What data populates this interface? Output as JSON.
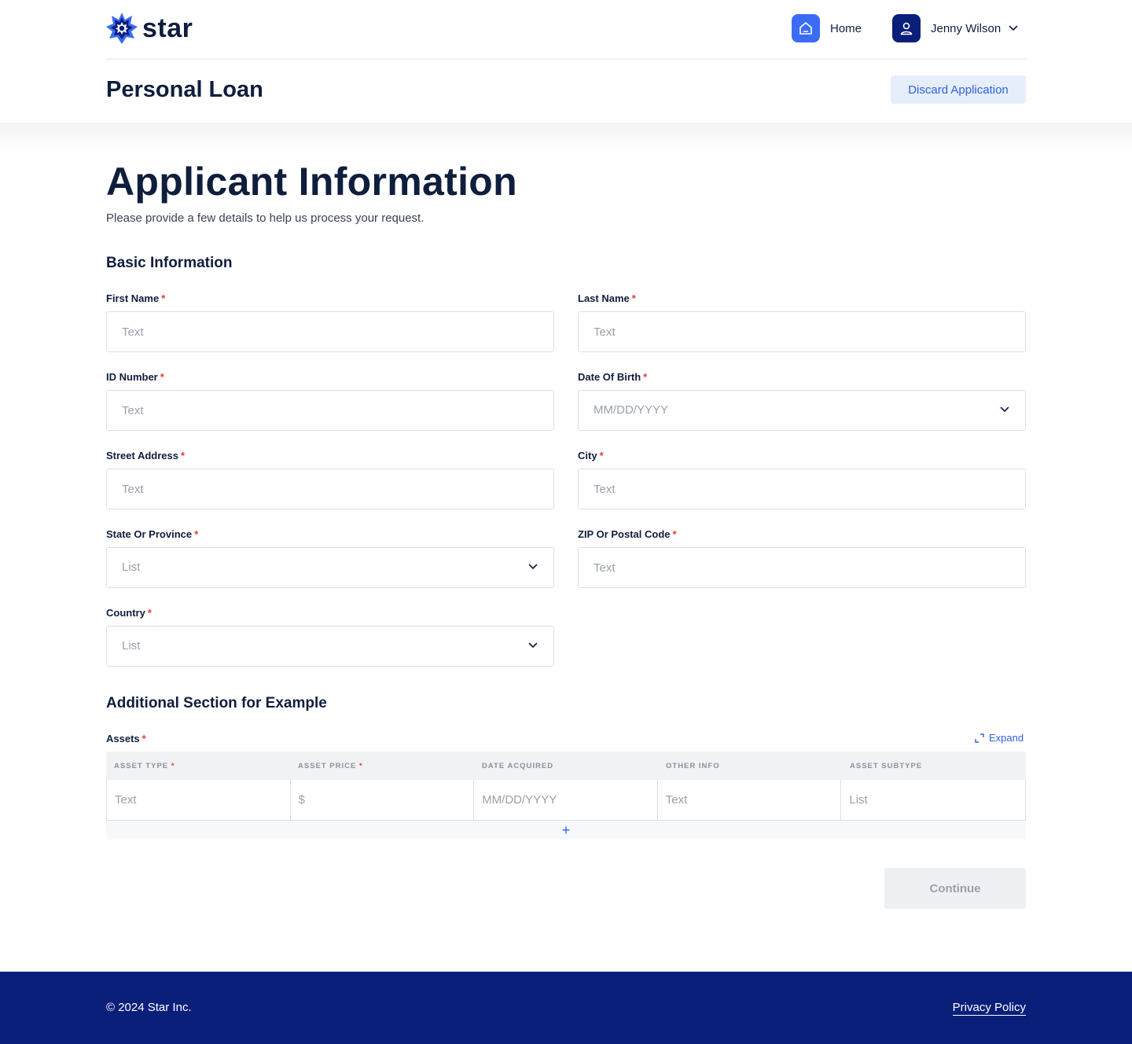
{
  "brand": {
    "name": "star",
    "accent": "#3b6cf6",
    "navy": "#0a1f7a"
  },
  "nav": {
    "home_label": "Home",
    "user_name": "Jenny Wilson"
  },
  "page": {
    "title": "Personal Loan",
    "discard_label": "Discard Application"
  },
  "main": {
    "title": "Applicant Information",
    "subtitle": "Please provide a few details to help us process your request."
  },
  "basic": {
    "title": "Basic Information",
    "first_name": {
      "label": "First Name",
      "placeholder": "Text"
    },
    "last_name": {
      "label": "Last Name",
      "placeholder": "Text"
    },
    "id_number": {
      "label": "ID Number",
      "placeholder": "Text"
    },
    "dob": {
      "label": "Date Of Birth",
      "placeholder": "MM/DD/YYYY"
    },
    "street": {
      "label": "Street Address",
      "placeholder": "Text"
    },
    "city": {
      "label": "City",
      "placeholder": "Text"
    },
    "state": {
      "label": "State Or Province",
      "placeholder": "List"
    },
    "zip": {
      "label": "ZIP Or Postal Code",
      "placeholder": "Text"
    },
    "country": {
      "label": "Country",
      "placeholder": "List"
    }
  },
  "additional": {
    "title": "Additional Section for Example",
    "assets_label": "Assets",
    "expand_label": "Expand",
    "add_symbol": "+",
    "columns": [
      {
        "label": "ASSET TYPE",
        "required": "*",
        "placeholder": "Text"
      },
      {
        "label": "ASSET PRICE",
        "required": "*",
        "placeholder": "$"
      },
      {
        "label": "DATE ACQUIRED",
        "required": "",
        "placeholder": "MM/DD/YYYY"
      },
      {
        "label": "OTHER INFO",
        "required": "",
        "placeholder": "Text"
      },
      {
        "label": "ASSET SUBTYPE",
        "required": "",
        "placeholder": "List"
      }
    ]
  },
  "continue_label": "Continue",
  "required_mark": "*",
  "footer": {
    "copyright": "© 2024 Star Inc.",
    "privacy": "Privacy Policy"
  }
}
